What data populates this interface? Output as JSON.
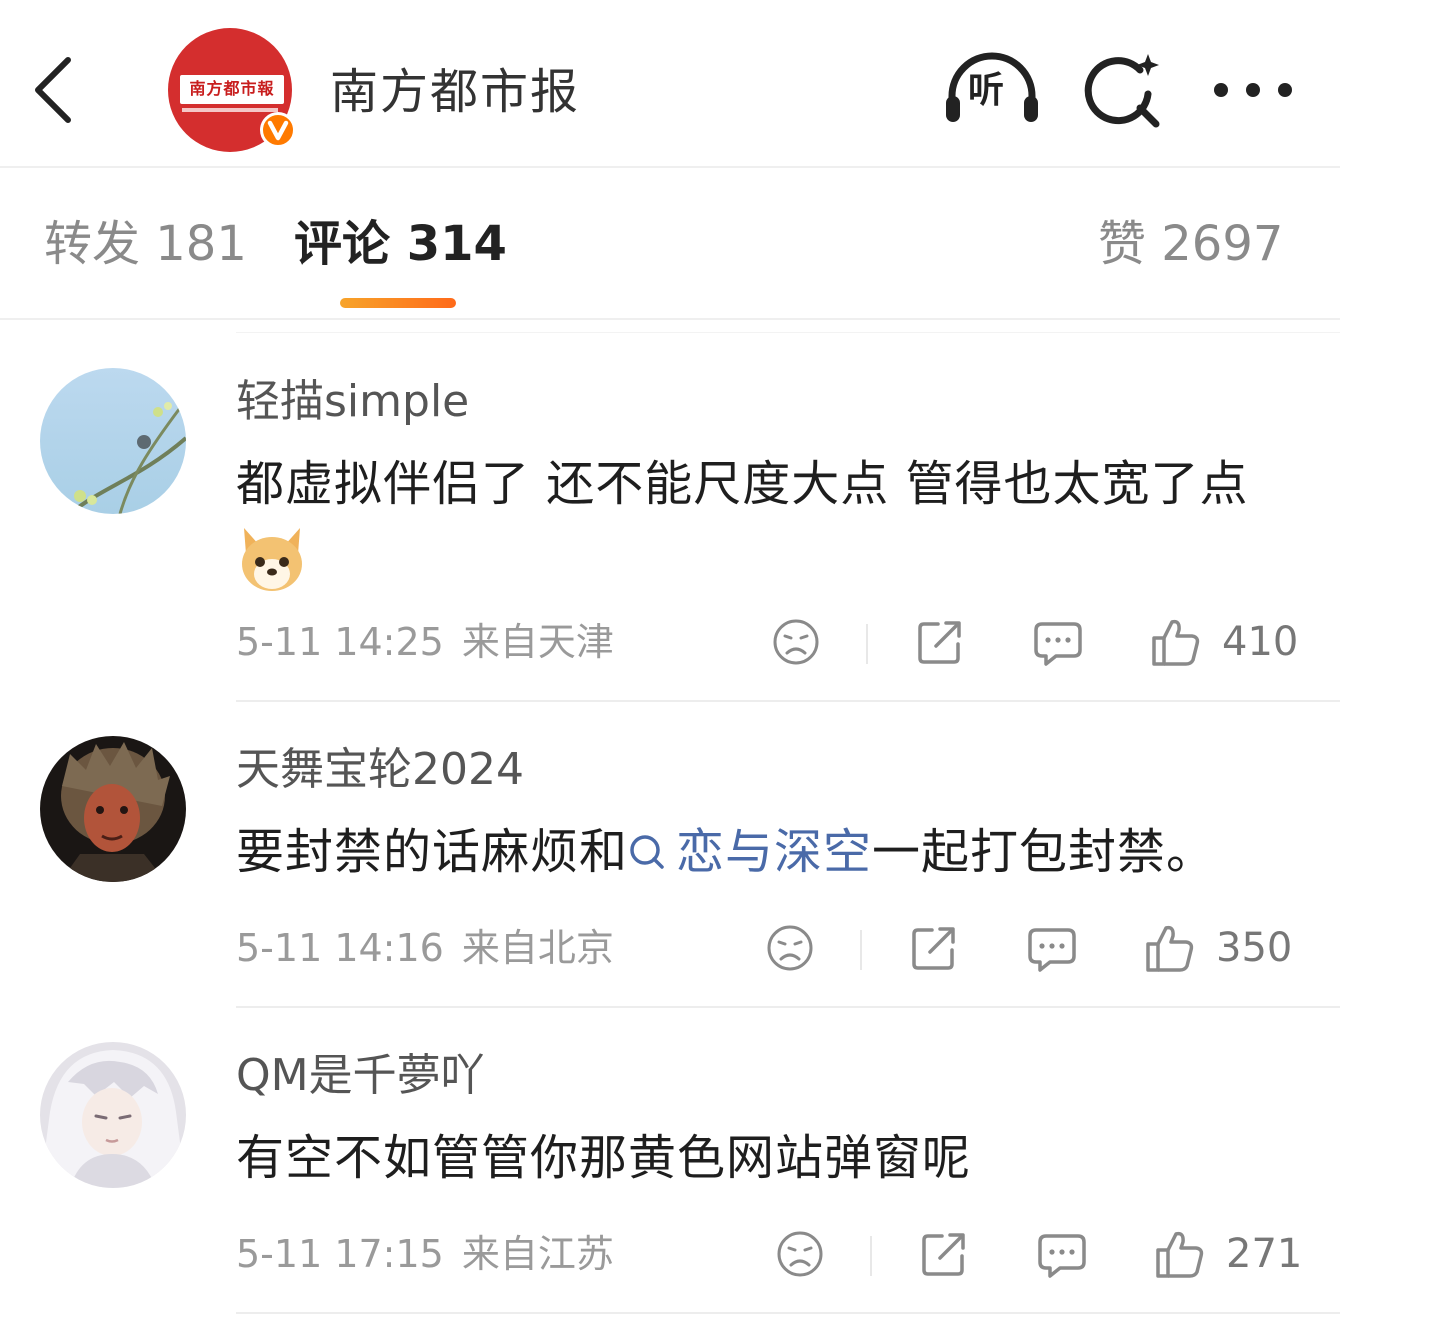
{
  "header": {
    "account_name": "南方都市报",
    "logo_text": "南方都市報",
    "listen_label": "听",
    "icons": [
      "back-chevron-icon",
      "headphones-icon",
      "search-sparkle-icon",
      "more-dots-icon"
    ]
  },
  "tabs": {
    "repost": "转发 181",
    "comments": "评论 314",
    "likes": "赞 2697",
    "active": "comments",
    "accent_color": "#ff7a1a"
  },
  "comments": [
    {
      "user": "轻描simple",
      "text": "都虚拟伴侣了 还不能尺度大点 管得也太宽了点",
      "emoji": "dog-emoji",
      "time": "5-11 14:25",
      "location": "来自天津",
      "likes": "410"
    },
    {
      "user": "天舞宝轮2024",
      "text_before": "要封禁的话麻烦和",
      "topic": "恋与深空",
      "text_after": "一起打包封禁。",
      "time": "5-11 14:16",
      "location": "来自北京",
      "likes": "350"
    },
    {
      "user": "QM是千夢吖",
      "text": "有空不如管管你那黄色网站弹窗呢",
      "time": "5-11 17:15",
      "location": "来自江苏",
      "likes": "271"
    }
  ],
  "colors": {
    "topic_link": "#4a6aa8",
    "brand_red": "#d42e2e",
    "verified_orange": "#ff7a00"
  }
}
